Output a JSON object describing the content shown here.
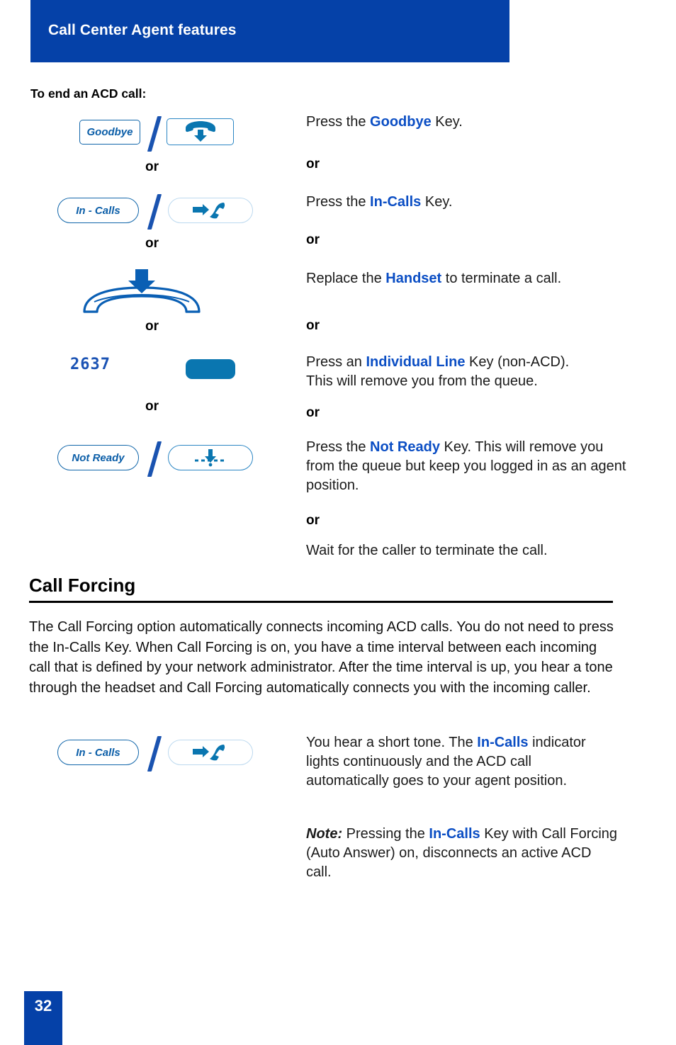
{
  "header": {
    "title": "Call Center Agent features",
    "band_color": "#0541a8"
  },
  "subhead": "To end an ACD call:",
  "or_label": "or",
  "colors": {
    "accent_blue": "#0541a8",
    "keyword_blue": "#0b4ec4",
    "key_outline": "#1166aa",
    "icon_blue": "#0a76b0",
    "line_key_fill": "#0a76b0"
  },
  "end_acd_steps": [
    {
      "softkey_label": "Goodbye",
      "hardkey_icon": "goodbye-handset-down-icon",
      "text_html": "Press the <b class=\"kw\">Goodbye</b> Key.",
      "text_plain": "Press the Goodbye Key."
    },
    {
      "softkey_label": "In - Calls",
      "hardkey_icon": "in-calls-arrow-handset-icon",
      "text_html": "Press the <b class=\"kw\">In-Calls</b> Key.",
      "text_plain": "Press the In-Calls Key."
    },
    {
      "softkey_label": "",
      "hardkey_icon": "handset-cradle-down-arrow-icon",
      "text_html": "Replace the <b class=\"kw\">Handset</b> to terminate a call.",
      "text_plain": "Replace the Handset to terminate a call."
    },
    {
      "softkey_label": "2637",
      "hardkey_icon": "individual-line-key-icon",
      "text_html": "Press an <b class=\"kw\">Individual Line</b> Key (non-ACD).<br>This will remove you from the queue.",
      "text_plain": "Press an Individual Line Key (non-ACD). This will remove you from the queue."
    },
    {
      "softkey_label": "Not Ready",
      "hardkey_icon": "not-ready-arrow-dot-icon",
      "text_html": "Press the <b class=\"kw\">Not Ready</b> Key. This will remove you from the queue but keep you logged in as an agent position.",
      "text_plain": "Press the Not Ready Key. This will remove you from the queue but keep you logged in as an agent position."
    }
  ],
  "final_step_text": "Wait for the caller to terminate the call.",
  "call_forcing": {
    "title": "Call Forcing",
    "body": "The Call Forcing option automatically connects incoming ACD calls. You do not need to press the In-Calls Key. When Call Forcing is on, you have a time interval between each incoming call that is defined by your network administrator. After the time interval is up, you hear a tone through the headset and Call Forcing automatically connects you with the incoming caller.",
    "softkey_label": "In - Calls",
    "hardkey_icon": "in-calls-arrow-handset-icon",
    "result_html": "You hear a short tone. The <b class=\"kw\">In-Calls</b> indicator lights continuously and the ACD call automatically goes to your agent position.",
    "result_plain": "You hear a short tone. The In-Calls indicator lights continuously and the ACD call automatically goes to your agent position.",
    "note_html": "<b><i>Note:</i></b> Pressing the <b class=\"kw\">In-Calls</b> Key with Call Forcing (Auto Answer) on, disconnects an active ACD call.",
    "note_plain": "Note: Pressing the In-Calls Key with Call Forcing (Auto Answer) on, disconnects an active ACD call."
  },
  "footer": {
    "page_number": "32"
  }
}
